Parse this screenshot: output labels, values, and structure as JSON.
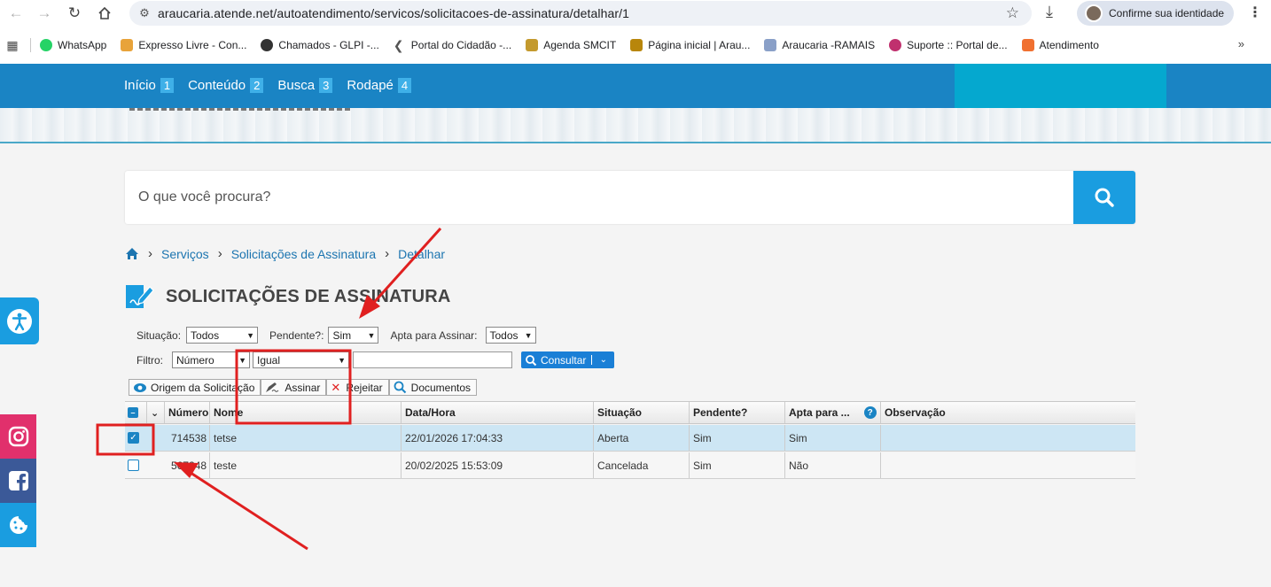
{
  "browser": {
    "url": "araucaria.atende.net/autoatendimento/servicos/solicitacoes-de-assinatura/detalhar/1",
    "profile_label": "Confirme sua identidade",
    "bookmarks": [
      {
        "label": "WhatsApp",
        "color": "#25d366"
      },
      {
        "label": "Expresso Livre - Con...",
        "color": "#e8a33a"
      },
      {
        "label": "Chamados - GLPI -...",
        "color": "#333333"
      },
      {
        "label": "Portal do Cidadão -...",
        "color": "#555555"
      },
      {
        "label": "Agenda SMCIT",
        "color": "#c49a2e"
      },
      {
        "label": "Página inicial | Arau...",
        "color": "#b8860b"
      },
      {
        "label": "Araucaria -RAMAIS",
        "color": "#8aa0c8"
      },
      {
        "label": "Suporte :: Portal de...",
        "color": "#c0306e"
      },
      {
        "label": "Atendimento",
        "color": "#f07030"
      }
    ],
    "bookmarks_more": "»"
  },
  "site_nav": {
    "links": [
      {
        "label": "Início",
        "num": "1"
      },
      {
        "label": "Conteúdo",
        "num": "2"
      },
      {
        "label": "Busca",
        "num": "3"
      },
      {
        "label": "Rodapé",
        "num": "4"
      }
    ]
  },
  "search": {
    "placeholder": "O que você procura?"
  },
  "breadcrumb": {
    "items": [
      "Serviços",
      "Solicitações de Assinatura",
      "Detalhar"
    ]
  },
  "page_title": "SOLICITAÇÕES DE ASSINATURA",
  "filters": {
    "situacao_label": "Situação:",
    "situacao_value": "Todos",
    "pendente_label": "Pendente?:",
    "pendente_value": "Sim",
    "apta_label": "Apta para Assinar:",
    "apta_value": "Todos",
    "filtro_label": "Filtro:",
    "filtro_field": "Número",
    "filtro_op": "Igual",
    "filtro_text": "",
    "consultar_label": "Consultar"
  },
  "toolbar": {
    "origem": "Origem da Solicitação",
    "assinar": "Assinar",
    "rejeitar": "Rejeitar",
    "documentos": "Documentos"
  },
  "grid": {
    "headers": {
      "numero": "Número",
      "nome": "Nome",
      "data": "Data/Hora",
      "situacao": "Situação",
      "pendente": "Pendente?",
      "apta": "Apta para ...",
      "help": "?",
      "observacao": "Observação"
    },
    "rows": [
      {
        "numero": "714538",
        "nome": "tetse",
        "data": "22/01/2026 17:04:33",
        "situacao": "Aberta",
        "pendente": "Sim",
        "apta": "Sim",
        "observacao": "",
        "checked": true
      },
      {
        "numero": "567248",
        "nome": "teste",
        "data": "20/02/2025 15:53:09",
        "situacao": "Cancelada",
        "pendente": "Sim",
        "apta": "Não",
        "observacao": "",
        "checked": false
      }
    ]
  },
  "colors": {
    "brand_blue": "#1a84c4",
    "accent": "#1a9de0",
    "annotation_red": "#e02020"
  }
}
